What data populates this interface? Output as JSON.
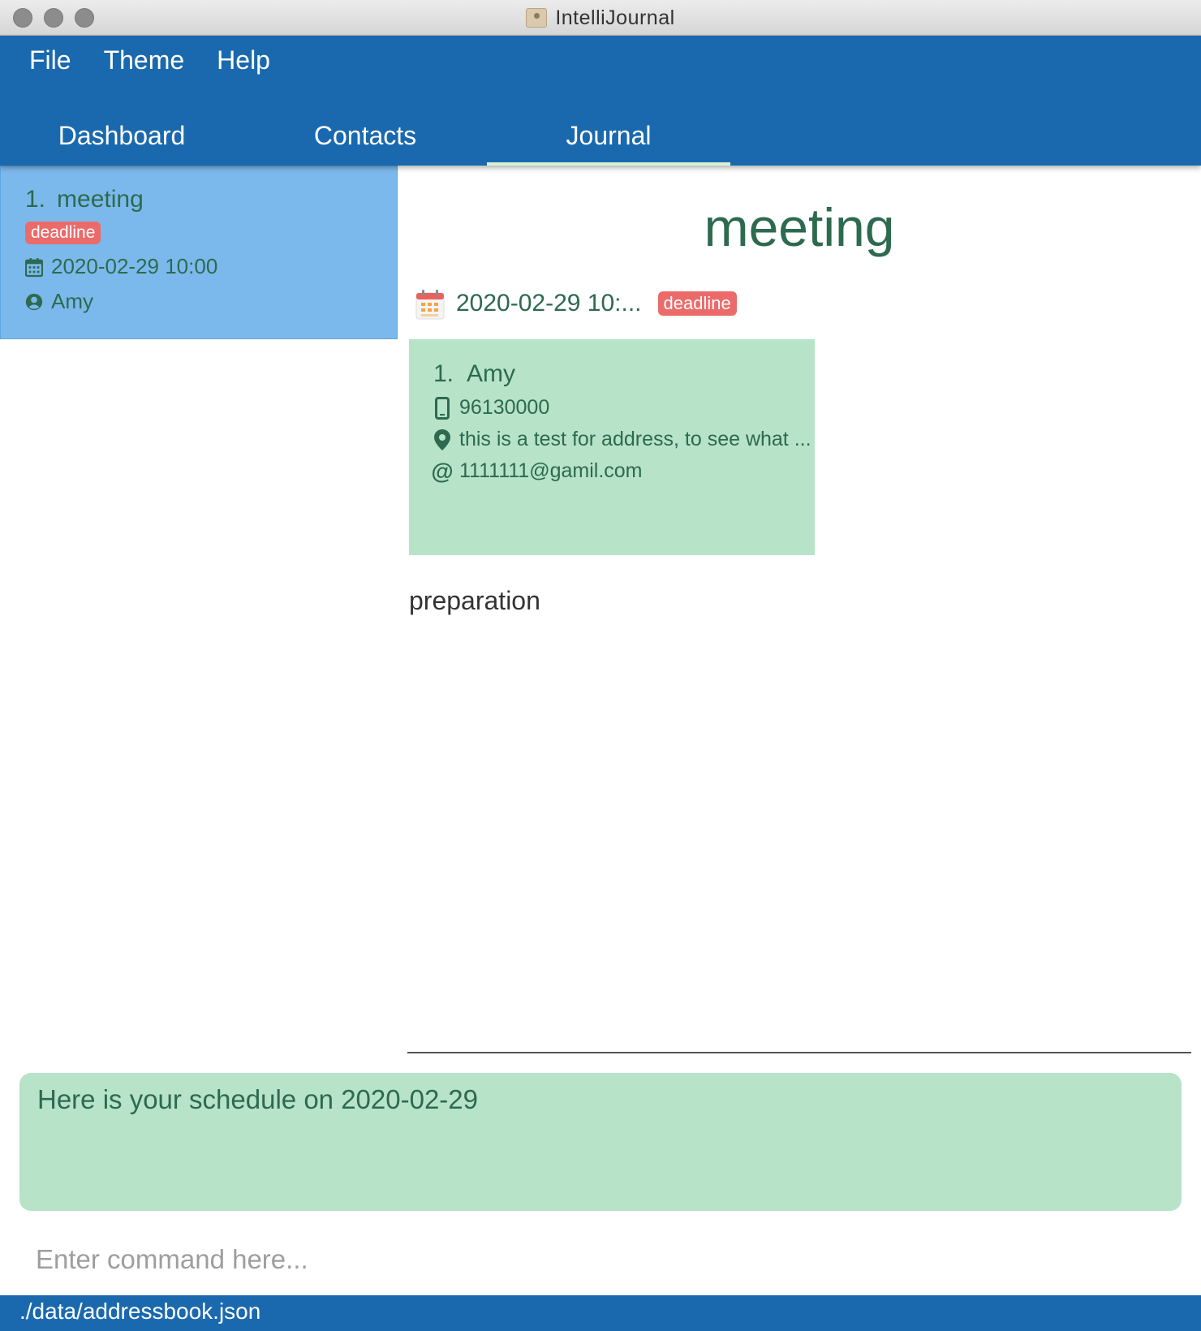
{
  "window": {
    "title": "IntelliJournal"
  },
  "menu": {
    "file": "File",
    "theme": "Theme",
    "help": "Help"
  },
  "tabs": [
    {
      "label": "Dashboard"
    },
    {
      "label": "Contacts"
    },
    {
      "label": "Journal",
      "active": true
    }
  ],
  "list": {
    "items": [
      {
        "index": "1.",
        "title": "meeting",
        "tag": "deadline",
        "datetime": "2020-02-29 10:00",
        "person": "Amy"
      }
    ]
  },
  "detail": {
    "title": "meeting",
    "datetime": "2020-02-29 10:...",
    "tag": "deadline",
    "contact": {
      "index": "1.",
      "name": "Amy",
      "phone": "96130000",
      "address": "this is a test for address, to see what ...",
      "email": "1111111@gamil.com"
    },
    "description": "preparation"
  },
  "result": {
    "text": "Here is your schedule on 2020-02-29"
  },
  "command": {
    "placeholder": "Enter command here..."
  },
  "status": {
    "path": "./data/addressbook.json"
  },
  "colors": {
    "header": "#1a69ae",
    "list_selected": "#7bb9ec",
    "card": "#b7e3c8",
    "tag": "#eb6b6b",
    "text": "#2d6a4f"
  }
}
